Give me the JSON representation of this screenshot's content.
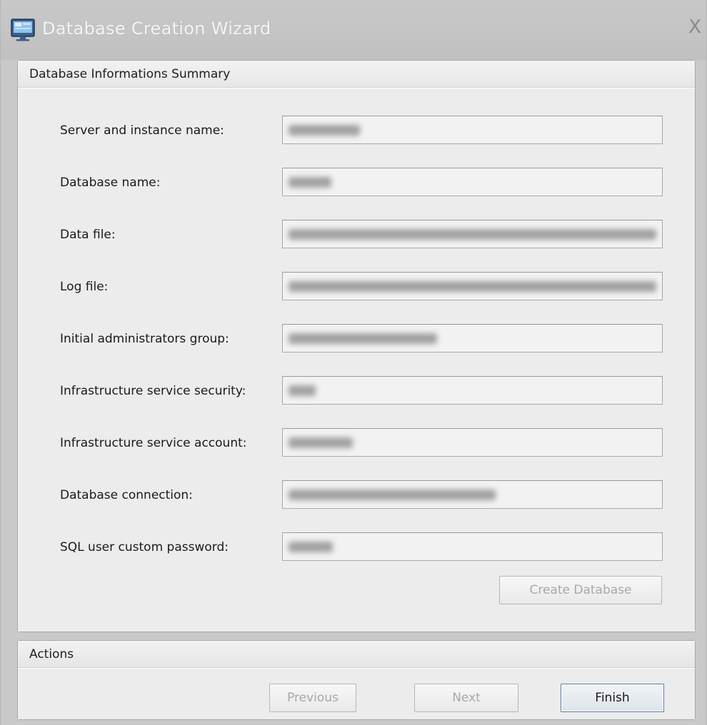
{
  "window": {
    "title": "Database Creation Wizard",
    "close_glyph": "X"
  },
  "summary_panel": {
    "header": "Database Informations Summary",
    "fields": [
      {
        "label": "Server and instance name:"
      },
      {
        "label": "Database name:"
      },
      {
        "label": "Data file:"
      },
      {
        "label": "Log file:"
      },
      {
        "label": "Initial administrators group:"
      },
      {
        "label": "Infrastructure service security:"
      },
      {
        "label": "Infrastructure service account:"
      },
      {
        "label": "Database connection:"
      },
      {
        "label": "SQL user custom password:"
      }
    ],
    "create_button": "Create Database"
  },
  "actions_panel": {
    "header": "Actions",
    "previous_button": "Previous",
    "next_button": "Next",
    "finish_button": "Finish"
  },
  "icons": {
    "app": "database-wizard-icon",
    "close": "close-icon"
  }
}
